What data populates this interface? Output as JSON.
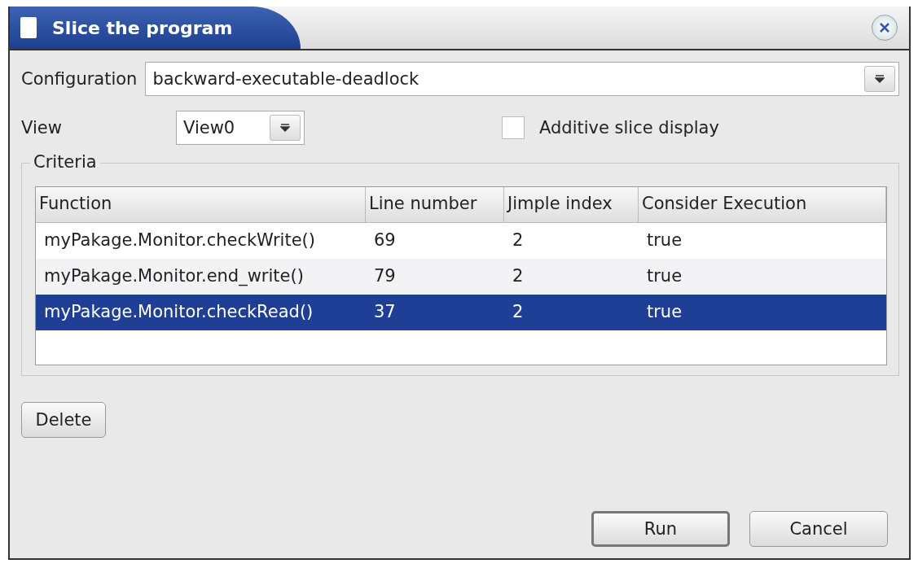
{
  "window": {
    "title": "Slice the program"
  },
  "configuration": {
    "label": "Configuration",
    "value": "backward-executable-deadlock"
  },
  "view": {
    "label": "View",
    "value": "View0"
  },
  "additive": {
    "label": "Additive slice display",
    "checked": false
  },
  "criteria": {
    "title": "Criteria",
    "columns": [
      "Function",
      "Line number",
      "Jimple index",
      "Consider Execution"
    ],
    "rows": [
      {
        "cells": [
          "myPakage.Monitor.checkWrite()",
          "69",
          "2",
          "true"
        ],
        "selected": false
      },
      {
        "cells": [
          "myPakage.Monitor.end_write()",
          "79",
          "2",
          "true"
        ],
        "selected": false
      },
      {
        "cells": [
          "myPakage.Monitor.checkRead()",
          "37",
          "2",
          "true"
        ],
        "selected": true
      }
    ]
  },
  "delete_button": "Delete",
  "buttons": [
    {
      "label": "Run",
      "default": true
    },
    {
      "label": "Cancel",
      "default": false
    }
  ]
}
